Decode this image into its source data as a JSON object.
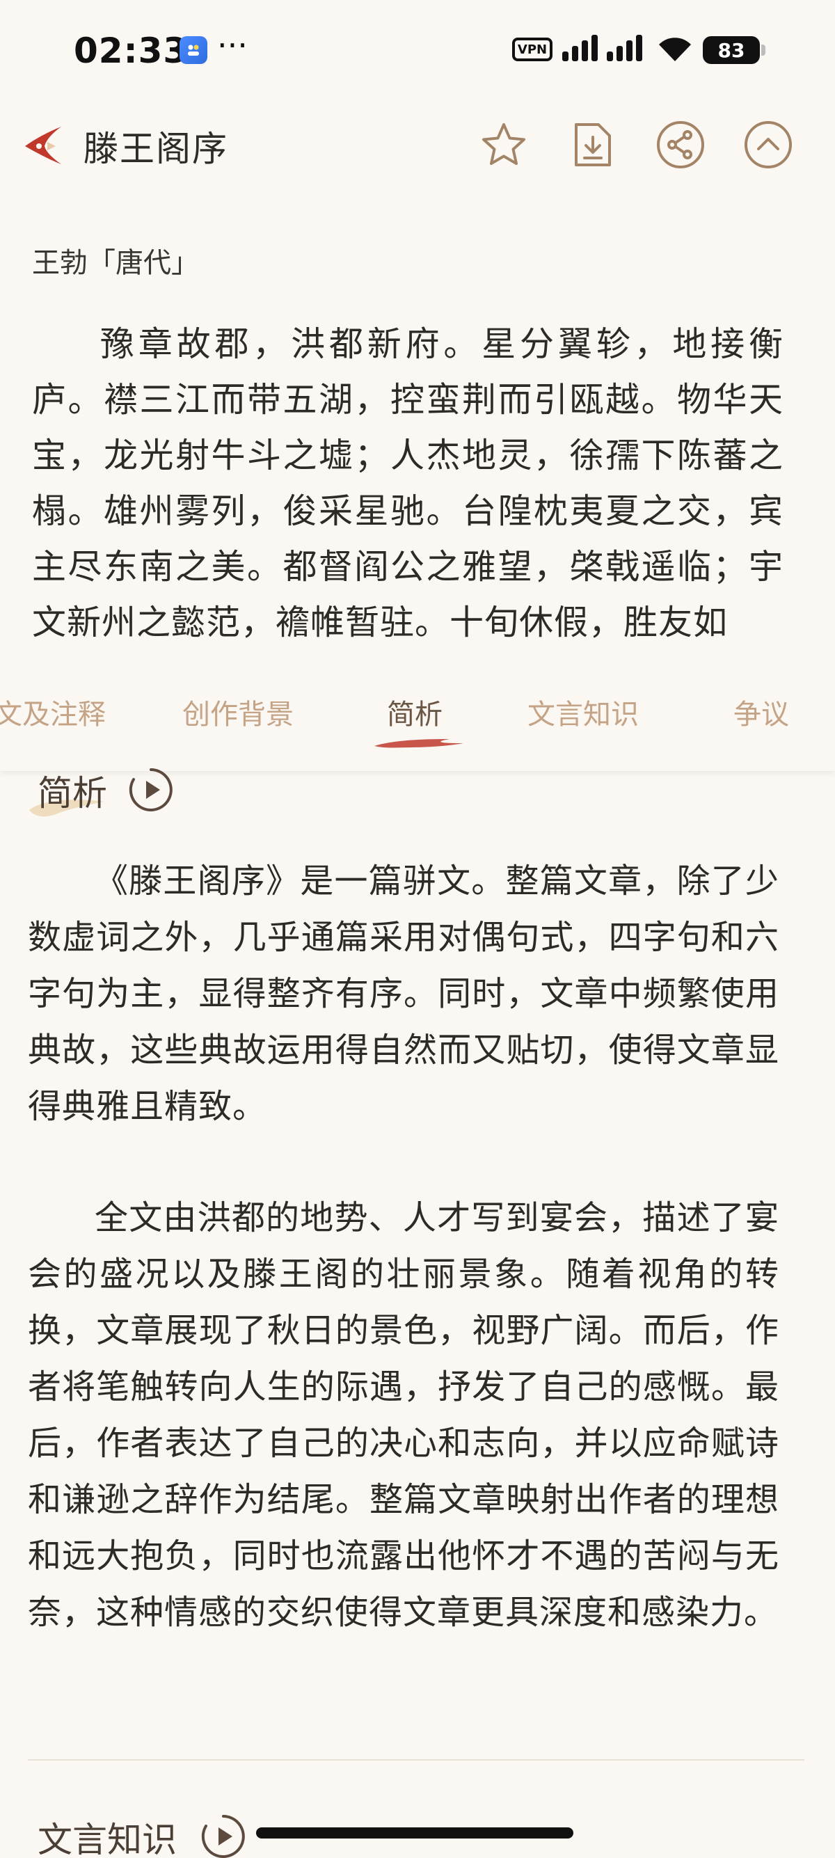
{
  "status_bar": {
    "time": "02:33",
    "more": "···",
    "vpn": "VPN",
    "battery": "83"
  },
  "header": {
    "title": "滕王阁序",
    "actions": [
      "star-icon",
      "download-icon",
      "share-icon",
      "collapse-icon"
    ]
  },
  "poem": {
    "author": "王勃「唐代」",
    "text": "豫章故郡，洪都新府。星分翼轸，地接衡庐。襟三江而带五湖，控蛮荆而引瓯越。物华天宝，龙光射牛斗之墟；人杰地灵，徐孺下陈蕃之榻。雄州雾列，俊采星驰。台隍枕夷夏之交，宾主尽东南之美。都督阎公之雅望，棨戟遥临；宇文新州之懿范，襜帷暂驻。十旬休假，胜友如"
  },
  "tabs": [
    {
      "label": "文及注释"
    },
    {
      "label": "创作背景"
    },
    {
      "label": "简析"
    },
    {
      "label": "文言知识"
    },
    {
      "label": "争议"
    }
  ],
  "active_tab": "简析",
  "analysis": {
    "title": "简析",
    "paragraphs": [
      "《滕王阁序》是一篇骈文。整篇文章，除了少数虚词之外，几乎通篇采用对偶句式，四字句和六字句为主，显得整齐有序。同时，文章中频繁使用典故，这些典故运用得自然而又贴切，使得文章显得典雅且精致。",
      "全文由洪都的地势、人才写到宴会，描述了宴会的盛况以及滕王阁的壮丽景象。随着视角的转换，文章展现了秋日的景色，视野广阔。而后，作者将笔触转向人生的际遇，抒发了自己的感慨。最后，作者表达了自己的决心和志向，并以应命赋诗和谦逊之辞作为结尾。整篇文章映射出作者的理想和远大抱负，同时也流露出他怀才不遇的苦闷与无奈，这种情感的交织使得文章更具深度和感染力。"
    ]
  },
  "next_section": {
    "title": "文言知识"
  },
  "colors": {
    "background": "#fbf8f3",
    "accent": "#c4a386",
    "accent_dark": "#6b5644",
    "brand_red": "#c0392b",
    "text": "#2d2a27"
  }
}
